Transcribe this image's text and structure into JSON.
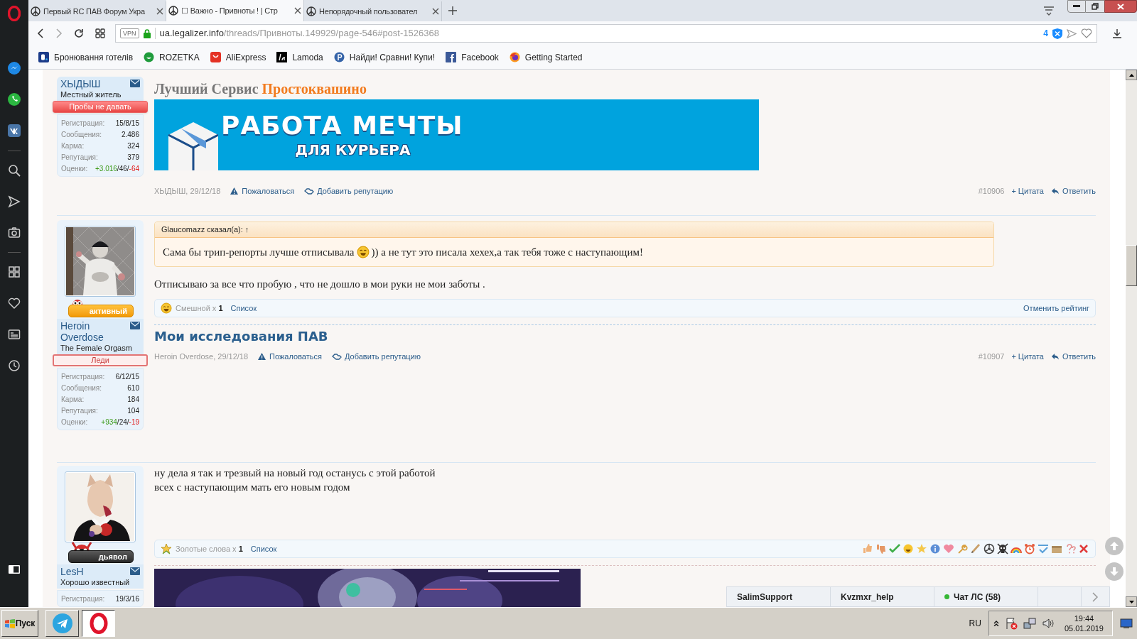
{
  "browser": {
    "tabs": [
      {
        "title": "Первый RC ПАВ Форум Укра",
        "selected": false
      },
      {
        "title": "☐ Важно - Привноты ! | Стр",
        "selected": true
      },
      {
        "title": "Непорядочный пользовател",
        "selected": false
      }
    ],
    "address": {
      "vpn": "VPN",
      "host": "ua.legalizer.info",
      "path": "/threads/Привноты.149929/page-546#post-1526368",
      "blocked_count": "4"
    },
    "bookmarks": [
      {
        "label": "Бронювання готелів",
        "kind": "booking"
      },
      {
        "label": "ROZETKA",
        "kind": "rozetka"
      },
      {
        "label": "AliExpress",
        "kind": "aliexpress"
      },
      {
        "label": "Lamoda",
        "kind": "lamoda"
      },
      {
        "label": "Найди! Сравни! Купи!",
        "kind": "price"
      },
      {
        "label": "Facebook",
        "kind": "facebook"
      },
      {
        "label": "Getting Started",
        "kind": "firefox"
      }
    ]
  },
  "posts": [
    {
      "user": {
        "name": "ХЫДЫШ",
        "title": "Местный житель",
        "banner": {
          "label": "Пробы не давать",
          "kind": "solid"
        },
        "stats": [
          {
            "label": "Регистрация:",
            "value": "15/8/15"
          },
          {
            "label": "Сообщения:",
            "value": "2.486"
          },
          {
            "label": "Карма:",
            "value": "324"
          },
          {
            "label": "Репутация:",
            "value": "379"
          }
        ],
        "ratings_label": "Оценки:",
        "ratings": [
          {
            "text": "+3.016",
            "kind": "positive"
          },
          {
            "text": "/46/",
            "kind": "neutral"
          },
          {
            "text": "-64",
            "kind": "negative"
          }
        ]
      },
      "body": [
        {
          "kind": "promo-title",
          "text": "Лучший Сервис",
          "accent": "Простоквашино"
        },
        {
          "kind": "banner",
          "line1": "РАБОТА МЕЧТЫ",
          "line2": "ДЛЯ КУРЬЕРА"
        }
      ],
      "meta": {
        "author_date": "ХЫДЫШ, 29/12/18",
        "report": "Пожаловаться",
        "add_rep": "Добавить репутацию",
        "number": "#10906",
        "quote": "+ Цитата",
        "reply": "Ответить"
      }
    },
    {
      "user": {
        "name": "Heroin Overdose",
        "title": "The Female Orgasm",
        "avatar": {
          "kind": "picture"
        },
        "rank": {
          "label": "активный",
          "kind": "owl"
        },
        "banner": {
          "label": "Леди",
          "kind": "outline"
        },
        "stats": [
          {
            "label": "Регистрация:",
            "value": "6/12/15"
          },
          {
            "label": "Сообщения:",
            "value": "610"
          },
          {
            "label": "Карма:",
            "value": "184"
          },
          {
            "label": "Репутация:",
            "value": "104"
          }
        ],
        "ratings_label": "Оценки:",
        "ratings": [
          {
            "text": "+934",
            "kind": "positive"
          },
          {
            "text": "/24/",
            "kind": "neutral"
          },
          {
            "text": "-19",
            "kind": "negative"
          }
        ]
      },
      "body": [
        {
          "kind": "quote",
          "author": "Glaucomazz сказал(а): ↑",
          "text_before": "Сама бы трип-репорты лучше отписывала",
          "text_after": ")) а не тут это писала хехех,а так тебя тоже с наступающим!"
        },
        {
          "kind": "text",
          "lines": [
            "Отписываю за все что пробую , что не дошло в мои руки не мои заботы ."
          ]
        }
      ],
      "rating_bar": {
        "kind": "funny",
        "label": "Смешной x",
        "count": "1",
        "list": "Список",
        "undo": "Отменить рейтинг",
        "rate_options": false
      },
      "after": [
        {
          "kind": "heading",
          "text": "Мои исследования ПАВ"
        }
      ],
      "meta": {
        "author_date": "Heroin Overdose, 29/12/18",
        "report": "Пожаловаться",
        "add_rep": "Добавить репутацию",
        "number": "#10907",
        "quote": "+ Цитата",
        "reply": "Ответить"
      }
    },
    {
      "user": {
        "name": "LesH",
        "title": "Хорошо известный",
        "avatar": {
          "kind": "picture"
        },
        "rank": {
          "label": "дьявол",
          "kind": "devil"
        },
        "stats": [
          {
            "label": "Регистрация:",
            "value": "19/3/16"
          }
        ]
      },
      "body": [
        {
          "kind": "text",
          "lines": [
            "ну дела я так и трезвый на новый год останусь с этой работой",
            "всех с наступающим мать его новым годом"
          ]
        }
      ],
      "rating_bar": {
        "kind": "gold",
        "label": "Золотые слова x",
        "count": "1",
        "list": "Список",
        "rate_options": true
      },
      "after": [
        {
          "kind": "picture"
        }
      ]
    }
  ],
  "chat_bar": {
    "tabs": [
      {
        "label": "SalimSupport",
        "online": false
      },
      {
        "label": "Kvzmxr_help",
        "online": false
      },
      {
        "label": "Чат ЛС (58)",
        "online": true
      }
    ]
  },
  "taskbar": {
    "start": "Пуск",
    "language": "RU",
    "time": "19:44",
    "date": "05.01.2019"
  }
}
